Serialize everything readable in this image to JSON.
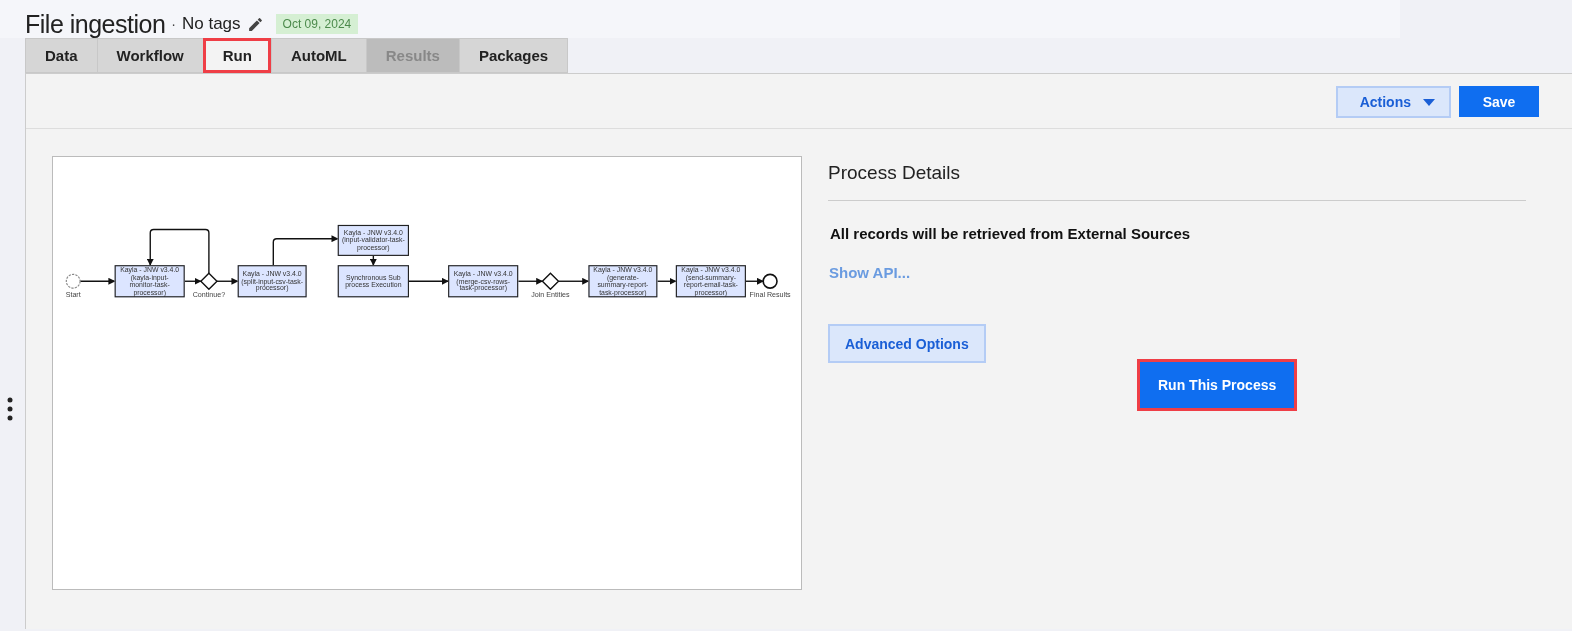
{
  "header": {
    "title": "File ingestion",
    "separator": "·",
    "tags": "No tags",
    "date": "Oct 09, 2024"
  },
  "tabs": [
    {
      "label": "Data",
      "selected": false,
      "disabled": false,
      "highlighted": false
    },
    {
      "label": "Workflow",
      "selected": false,
      "disabled": false,
      "highlighted": false
    },
    {
      "label": "Run",
      "selected": true,
      "disabled": false,
      "highlighted": true
    },
    {
      "label": "AutoML",
      "selected": false,
      "disabled": false,
      "highlighted": false
    },
    {
      "label": "Results",
      "selected": false,
      "disabled": true,
      "highlighted": false
    },
    {
      "label": "Packages",
      "selected": false,
      "disabled": false,
      "highlighted": false
    }
  ],
  "toolbar": {
    "actions": "Actions",
    "save": "Save"
  },
  "diagram": {
    "nodes": [
      {
        "kind": "start",
        "label": "Start"
      },
      {
        "kind": "task",
        "label": "Kayla - JNW v3.4.0 (kayla-input-monitor-task-processor)"
      },
      {
        "kind": "gateway",
        "label": "Continue?"
      },
      {
        "kind": "task",
        "label": "Kayla - JNW v3.4.0 (split-input-csv-task-processor)"
      },
      {
        "kind": "task",
        "label": "Kayla - JNW v3.4.0 (input-validator-task-processor)"
      },
      {
        "kind": "subprocess",
        "label": "Synchronous Sub process Execution"
      },
      {
        "kind": "task",
        "label": "Kayla - JNW v3.4.0 (merge-csv-rows-task-processor)"
      },
      {
        "kind": "gateway",
        "label": "Join Entities"
      },
      {
        "kind": "task",
        "label": "Kayla - JNW v3.4.0 (generate-summary-report-task-processor)"
      },
      {
        "kind": "task",
        "label": "Kayla - JNW v3.4.0 (send-summary-report-email-task-processor)"
      },
      {
        "kind": "end",
        "label": "Final Results"
      }
    ]
  },
  "details": {
    "title": "Process Details",
    "message": "All records will be retrieved from External Sources",
    "api_link": "Show API...",
    "advanced": "Advanced Options",
    "run": {
      "label": "Run This Process",
      "highlighted": true
    }
  }
}
